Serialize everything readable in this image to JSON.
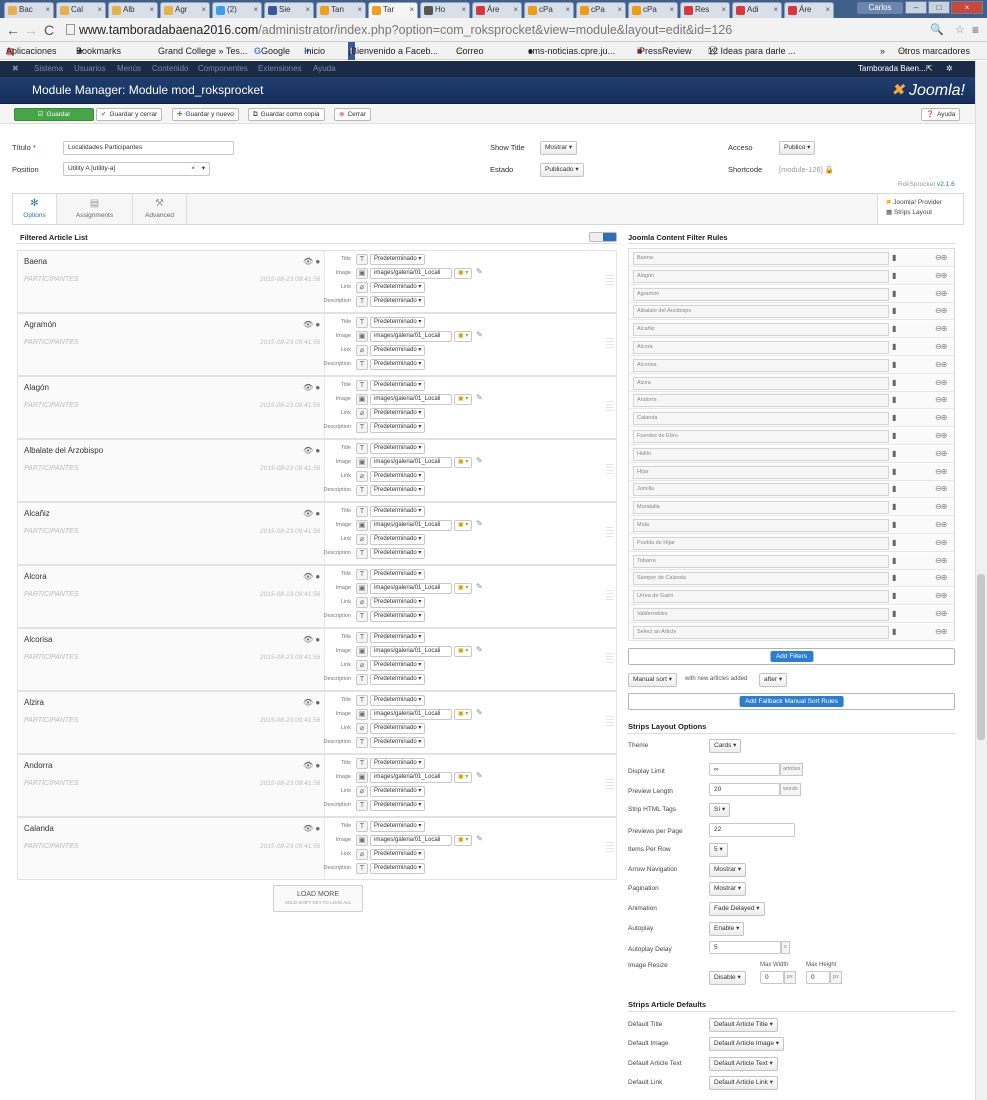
{
  "browser": {
    "tabs": [
      {
        "label": "Bac",
        "color": "#e8b04b"
      },
      {
        "label": "Cal",
        "color": "#e8b04b"
      },
      {
        "label": "Alb",
        "color": "#e8b04b"
      },
      {
        "label": "Agr",
        "color": "#e8b04b"
      },
      {
        "label": "(2)",
        "color": "#3b9ee8"
      },
      {
        "label": "Sie",
        "color": "#3b5998"
      },
      {
        "label": "Tan",
        "color": "#f0a020"
      },
      {
        "label": "Tar",
        "color": "#f0a020",
        "active": true
      },
      {
        "label": "Ho",
        "color": "#555"
      },
      {
        "label": "Áre",
        "color": "#d9363e"
      },
      {
        "label": "cPa",
        "color": "#f39c12"
      },
      {
        "label": "cPa",
        "color": "#f39c12"
      },
      {
        "label": "cPa",
        "color": "#f39c12"
      },
      {
        "label": "Res",
        "color": "#d9363e"
      },
      {
        "label": "Adi",
        "color": "#d9363e"
      },
      {
        "label": "Áre",
        "color": "#d9363e"
      }
    ],
    "tab_close": "×",
    "user": "Carlos",
    "url_domain": "www.tamboradabaena2016.com",
    "url_path": "/administrator/index.php?option=com_roksprocket&view=module&layout=edit&id=126",
    "bookmarks": [
      "Aplicaciones",
      "Bookmarks",
      "Grand College » Tes...",
      "Google",
      "Inicio",
      "¡Bienvenido a Faceb...",
      "Correo",
      "cms-noticias.cpre.ju...",
      "iPressReview",
      "12 Ideas para darle ..."
    ],
    "bookmarks_more": "»",
    "bookmarks_other": "Otros marcadores"
  },
  "joomla": {
    "menu": [
      "Sistema",
      "Usuarios",
      "Menús",
      "Contenido",
      "Componentes",
      "Extensiones",
      "Ayuda"
    ],
    "site_user": "Tamborada Baen...",
    "page_title": "Module Manager: Module mod_roksprocket",
    "logo": "Joomla!",
    "toolbar": {
      "save": "Guardar",
      "save_close": "Guardar y cerrar",
      "save_new": "Guardar y nuevo",
      "save_copy": "Guardar como copia",
      "close": "Cerrar",
      "help": "Ayuda"
    }
  },
  "form": {
    "title_label": "Título",
    "title_required": "*",
    "title_value": "Localidades Participantes",
    "position_label": "Position",
    "position_value": "Utility A [utility-a]",
    "position_clear": "×",
    "show_title_label": "Show Title",
    "show_title_value": "Mostrar",
    "estado_label": "Estado",
    "estado_value": "Publicado",
    "acceso_label": "Acceso",
    "acceso_value": "Publico",
    "shortcode_label": "Shortcode",
    "shortcode_value": "[module-126]",
    "version_label": "RokSprocket",
    "version_value": "v2.1.6"
  },
  "tabs": [
    {
      "label": "Options",
      "icon": "✻",
      "active": true
    },
    {
      "label": "Assignments",
      "icon": "▤"
    },
    {
      "label": "Advanced",
      "icon": "⚒"
    }
  ],
  "provider": {
    "line1": "Joomla! Provider",
    "line2": "Strips Layout"
  },
  "articles_title": "Filtered Article List",
  "field_labels": {
    "title": "Title",
    "image": "Image",
    "link": "Link",
    "description": "Description"
  },
  "field_value": "Predeterminado",
  "image_value": "images/galeria/01_Locali",
  "articles": [
    {
      "name": "Baena",
      "category": "PARTICIPANTES",
      "date": "2015-08-23 09:41:56"
    },
    {
      "name": "Agramón",
      "category": "PARTICIPANTES",
      "date": "2015-08-23 09:41:56"
    },
    {
      "name": "Alagón",
      "category": "PARTICIPANTES",
      "date": "2015-08-23 09:41:56"
    },
    {
      "name": "Albalate del Arzobispo",
      "category": "PARTICIPANTES",
      "date": "2015-08-23 09:41:56"
    },
    {
      "name": "Alcañiz",
      "category": "PARTICIPANTES",
      "date": "2015-08-23 09:41:56"
    },
    {
      "name": "Alcora",
      "category": "PARTICIPANTES",
      "date": "2015-08-23 09:41:56"
    },
    {
      "name": "Alcorisa",
      "category": "PARTICIPANTES",
      "date": "2015-08-23 09:41:56"
    },
    {
      "name": "Alzira",
      "category": "PARTICIPANTES",
      "date": "2015-08-23 09:41:56"
    },
    {
      "name": "Andorra",
      "category": "PARTICIPANTES",
      "date": "2015-08-23 09:41:56"
    },
    {
      "name": "Calanda",
      "category": "PARTICIPANTES",
      "date": "2015-08-23 09:41:56"
    }
  ],
  "load_more": {
    "label": "LOAD MORE",
    "hint": "HOLD SHIFT KEY TO LOAD ALL"
  },
  "filters_title": "Joomla Content Filter Rules",
  "filters": [
    "Baena",
    "Alagón",
    "Agramón",
    "Albalate del Arzobispo",
    "Alcañiz",
    "Alcora",
    "Alcorisa",
    "Alzira",
    "Andorra",
    "Calanda",
    "Fuentes de Ebro",
    "Hellín",
    "Híjar",
    "Jumilla",
    "Moratalla",
    "Mula",
    "Puebla de Híjar",
    "Tobarra",
    "Samper de Calanda",
    "Urrea de Gaén",
    "Valderrobles",
    "Select an Article"
  ],
  "add_filters": "Add Filters",
  "sort": {
    "mode": "Manual sort",
    "text": "with new articles added",
    "position": "after"
  },
  "add_fallback": "Add Fallback Manual Sort Rules",
  "layout_title": "Strips Layout Options",
  "layout": {
    "theme": {
      "label": "Theme",
      "value": "Cards"
    },
    "display_limit": {
      "label": "Display Limit",
      "value": "∞",
      "unit": "articles"
    },
    "preview_length": {
      "label": "Preview Length",
      "value": "20",
      "unit": "words"
    },
    "strip_html": {
      "label": "Strip HTML Tags",
      "value": "Sí"
    },
    "previews_per_page": {
      "label": "Previews per Page",
      "value": "22"
    },
    "items_per_row": {
      "label": "Items Per Row",
      "value": "5"
    },
    "arrow_nav": {
      "label": "Arrow Navigation",
      "value": "Mostrar"
    },
    "pagination": {
      "label": "Pagination",
      "value": "Mostrar"
    },
    "animation": {
      "label": "Animation",
      "value": "Fade Delayed"
    },
    "autoplay": {
      "label": "Autoplay",
      "value": "Enable"
    },
    "autoplay_delay": {
      "label": "Autoplay Delay",
      "value": "5",
      "unit": "s"
    },
    "image_resize": {
      "label": "Image Resize",
      "value": "Disable",
      "max_width_label": "Max Width",
      "max_width": "0",
      "max_height_label": "Max Height",
      "max_height": "0",
      "unit": "px"
    }
  },
  "defaults_title": "Strips Article Defaults",
  "defaults": {
    "title": {
      "label": "Default Title",
      "value": "Default Article Title"
    },
    "image": {
      "label": "Default Image",
      "value": "Default Article Image"
    },
    "text": {
      "label": "Default Article Text",
      "value": "Default Article Text"
    },
    "link": {
      "label": "Default Link",
      "value": "Default Article Link"
    }
  },
  "icons": {
    "caret": "▾"
  }
}
